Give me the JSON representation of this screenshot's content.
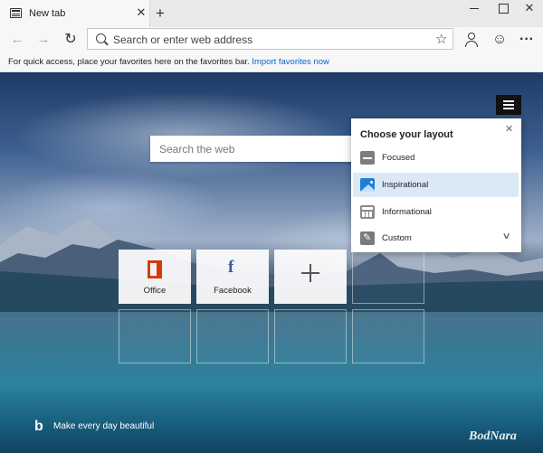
{
  "browser": {
    "tab_title": "New tab",
    "tab_close": "✕",
    "new_tab": "+",
    "window_close": "✕"
  },
  "toolbar": {
    "back": "←",
    "forward": "→",
    "refresh": "↻",
    "address_placeholder": "Search or enter web address",
    "star": "☆",
    "feedback": "☺",
    "more": "···"
  },
  "favorites_bar": {
    "message": "For quick access, place your favorites here on the favorites bar.",
    "import_link": "Import favorites now"
  },
  "new_tab_page": {
    "search_placeholder": "Search the web",
    "layout_panel": {
      "title": "Choose your layout",
      "close": "✕",
      "options": [
        {
          "label": "Focused",
          "icon": "focused-icon",
          "selected": false
        },
        {
          "label": "Inspirational",
          "icon": "inspirational-icon",
          "selected": true
        },
        {
          "label": "Informational",
          "icon": "informational-icon",
          "selected": false
        },
        {
          "label": "Custom",
          "icon": "custom-icon",
          "selected": false
        }
      ],
      "expand": "∨"
    },
    "quick_links": [
      {
        "label": "Office",
        "icon": "office-icon"
      },
      {
        "label": "Facebook",
        "icon": "facebook-icon",
        "glyph": "f"
      },
      {
        "label": "",
        "icon": "add-icon"
      }
    ],
    "bing": {
      "logo": "b",
      "tagline": "Make every day beautiful"
    },
    "watermark": "BodNara"
  },
  "colors": {
    "accent": "#0a63c8",
    "selected_option": "#dbe9f7",
    "office": "#d83b01",
    "facebook": "#3b5998"
  }
}
